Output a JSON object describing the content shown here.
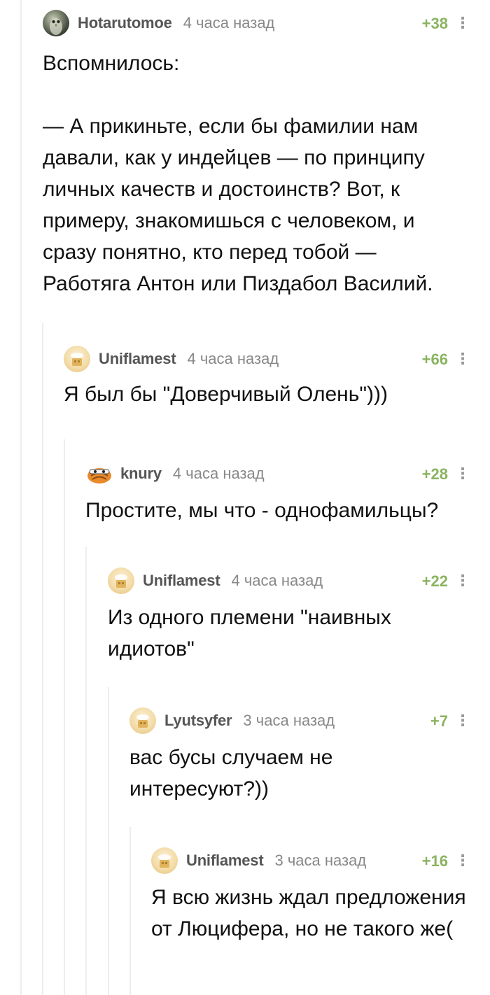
{
  "comments": [
    {
      "username": "Hotarutomoe",
      "time": "4 часа назад",
      "rating": "+38",
      "text": "Вспомнилось:\n\n— А прикиньте, если бы фамилии нам давали, как у индейцев — по принципу личных качеств и достоинств? Вот, к примеру, знакомишься с человеком, и сразу понятно, кто перед тобой — Работяга Антон или Пиздабол Василий.",
      "avatar": "owl-avatar",
      "more_icon": "⋮"
    },
    {
      "username": "Uniflamest",
      "time": "4 часа назад",
      "rating": "+66",
      "text": "Я был бы \"Доверчивый Олень\")))",
      "avatar": "default-avatar",
      "more_icon": "⋮"
    },
    {
      "username": "knury",
      "time": "4 часа назад",
      "rating": "+28",
      "text": "Простите, мы что - однофамильцы?",
      "avatar": "cat-avatar",
      "more_icon": "⋮"
    },
    {
      "username": "Uniflamest",
      "time": "4 часа назад",
      "rating": "+22",
      "text": "Из одного племени \"наивных идиотов\"",
      "avatar": "default-avatar",
      "more_icon": "⋮"
    },
    {
      "username": "Lyutsyfer",
      "time": "3 часа назад",
      "rating": "+7",
      "text": "вас бусы случаем не интересуют?))",
      "avatar": "default-avatar",
      "more_icon": "⋮"
    },
    {
      "username": "Uniflamest",
      "time": "3 часа назад",
      "rating": "+16",
      "text": "Я всю жизнь ждал предложения от Люцифера, но не такого же(",
      "avatar": "default-avatar",
      "more_icon": "⋮"
    }
  ],
  "colors": {
    "rating": "#8ab360",
    "username": "#555555",
    "timestamp": "#888888",
    "thread_line": "#ededed"
  }
}
